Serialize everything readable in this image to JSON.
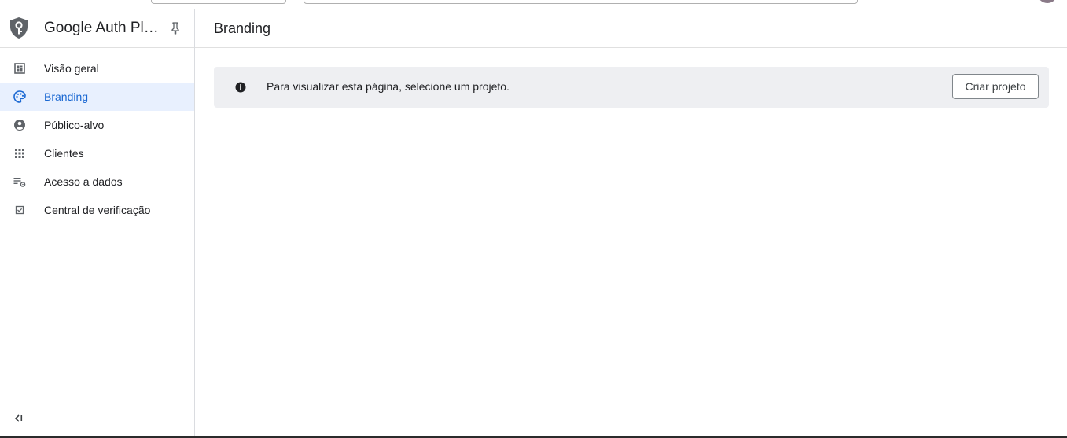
{
  "product": {
    "title": "Google Auth Pla...",
    "icon": "shield-key-icon"
  },
  "sidebar": {
    "items": [
      {
        "label": "Visão geral",
        "icon": "dashboard-icon",
        "active": false
      },
      {
        "label": "Branding",
        "icon": "palette-icon",
        "active": true
      },
      {
        "label": "Público-alvo",
        "icon": "account-circle-icon",
        "active": false
      },
      {
        "label": "Clientes",
        "icon": "apps-grid-icon",
        "active": false
      },
      {
        "label": "Acesso a dados",
        "icon": "list-settings-icon",
        "active": false
      },
      {
        "label": "Central de verificação",
        "icon": "checkbox-icon",
        "active": false
      }
    ],
    "collapse_icon": "collapse-left-icon"
  },
  "main": {
    "title": "Branding",
    "banner": {
      "message": "Para visualizar esta página, selecione um projeto.",
      "button_label": "Criar projeto"
    }
  },
  "colors": {
    "accent": "#1967d2",
    "active_bg": "#e8f0fe",
    "banner_bg": "#eeeff2"
  }
}
